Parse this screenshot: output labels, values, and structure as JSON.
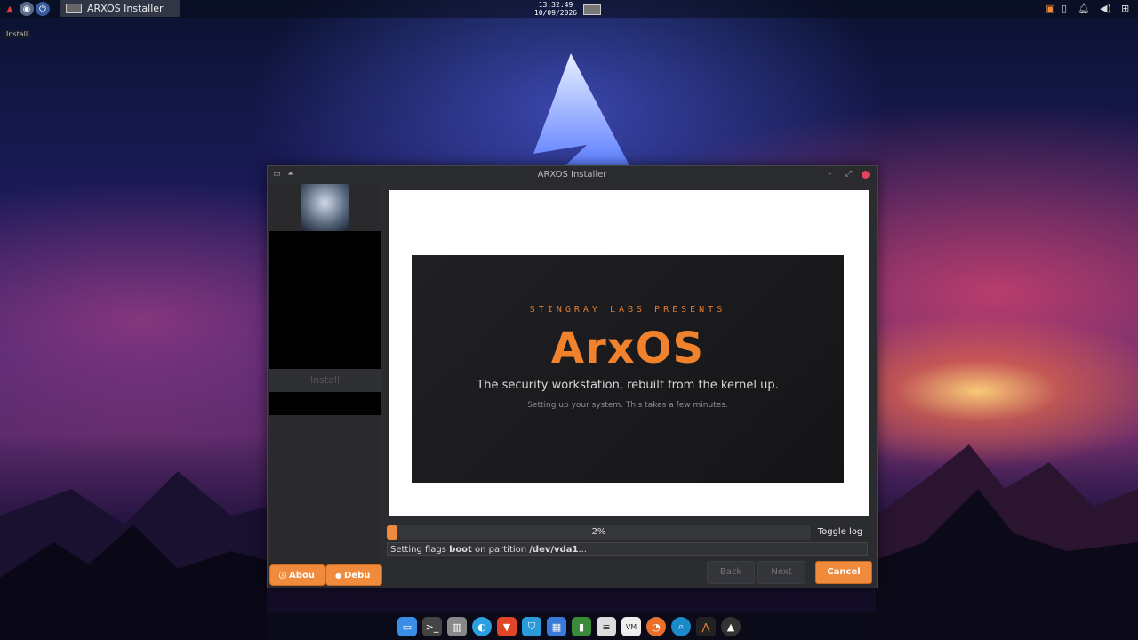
{
  "taskbar": {
    "window_button_label": "ARXOS Installer",
    "clock_time": "13:32:49",
    "clock_date": "10/09/2026",
    "tooltip": "Install"
  },
  "window": {
    "title": "ARXOS Installer"
  },
  "sidebar": {
    "install_label": "Install",
    "about_button": "Abou",
    "debug_button": "Debu"
  },
  "slide": {
    "presenter": "STINGRAY LABS PRESENTS",
    "product": "ArxOS",
    "tagline": "The security workstation, rebuilt from the kernel up.",
    "note": "Setting up your system. This takes a few minutes."
  },
  "progress": {
    "value_percent": 2,
    "label": "2%"
  },
  "toggle_log": "Toggle log",
  "status": {
    "prefix": "Setting flags ",
    "flag": "boot",
    "middle": " on partition ",
    "partition": "/dev/vda1",
    "suffix": "..."
  },
  "buttons": {
    "back": "Back",
    "next": "Next",
    "cancel": "Cancel"
  },
  "colors": {
    "accent": "#f08a3c"
  },
  "dock_icons": [
    "folder-icon",
    "terminal-icon",
    "trash-icon",
    "browser-icon",
    "brave-icon",
    "shield-icon",
    "calculator-icon",
    "notes-icon",
    "text-editor-icon",
    "vm-icon",
    "firefox-icon",
    "search-icon",
    "arxos-icon",
    "hooded-icon"
  ]
}
